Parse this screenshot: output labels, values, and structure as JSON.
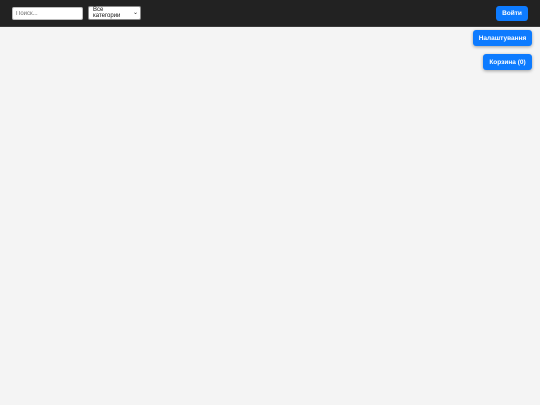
{
  "header": {
    "search": {
      "placeholder": "Поиск...",
      "value": ""
    },
    "category": {
      "selected": "Все категории"
    },
    "login_label": "Войти"
  },
  "floating": {
    "settings_label": "Налаштування",
    "cart_label": "Корзина (0)"
  },
  "colors": {
    "header_bg": "#222222",
    "page_bg": "#f4f4f4",
    "accent": "#0d7bff"
  },
  "icons": {
    "select_chevron": "chevron-down-icon"
  }
}
